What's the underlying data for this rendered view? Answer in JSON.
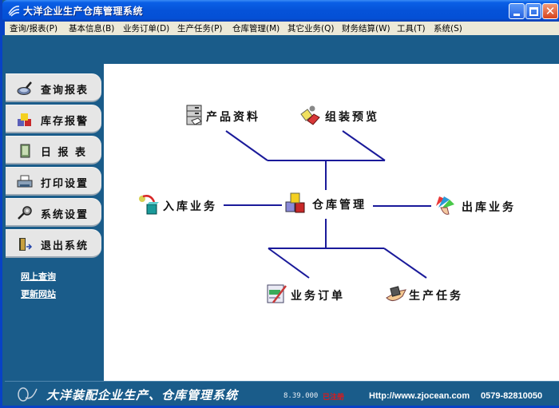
{
  "window": {
    "title": "大洋企业生产仓库管理系统",
    "controls": [
      "minimize",
      "maximize",
      "close"
    ]
  },
  "menu": [
    {
      "label": "查询/报表(P)"
    },
    {
      "label": "基本信息(B)"
    },
    {
      "label": "业务订单(D)"
    },
    {
      "label": "生产任务(P)"
    },
    {
      "label": "仓库管理(M)"
    },
    {
      "label": "其它业务(Q)"
    },
    {
      "label": "财务结算(W)"
    },
    {
      "label": "工具(T)"
    },
    {
      "label": "系统(S)"
    }
  ],
  "sidebar": {
    "buttons": [
      {
        "label": "查询报表",
        "icon": "magnifier-icon"
      },
      {
        "label": "库存报警",
        "icon": "stock-blocks-icon"
      },
      {
        "label": "日 报 表",
        "icon": "daily-report-icon"
      },
      {
        "label": "打印设置",
        "icon": "printer-icon"
      },
      {
        "label": "系统设置",
        "icon": "key-icon"
      },
      {
        "label": "退出系统",
        "icon": "exit-door-icon"
      }
    ],
    "links": [
      {
        "label": "网上查询"
      },
      {
        "label": "更新网站"
      }
    ]
  },
  "diagram": {
    "center": {
      "label": "仓库管理",
      "icon": "warehouse-blocks-icon"
    },
    "nodes": {
      "product_info": {
        "label": "产品资料",
        "icon": "file-cabinet-icon"
      },
      "assembly_preview": {
        "label": "组装预览",
        "icon": "assembly-icon"
      },
      "inbound": {
        "label": "入库业务",
        "icon": "inbound-box-icon"
      },
      "outbound": {
        "label": "出库业务",
        "icon": "outbound-cards-icon"
      },
      "orders": {
        "label": "业务订单",
        "icon": "order-form-icon"
      },
      "production": {
        "label": "生产任务",
        "icon": "production-hand-icon"
      }
    },
    "line_color": "#1a1a9a"
  },
  "footer": {
    "title": "大洋装配企业生产、仓库管理系统",
    "version": "8.39.000",
    "badge": "已注册",
    "url": "Http://www.zjocean.com",
    "phone": "0579-82810050"
  },
  "colors": {
    "panel_blue": "#1a5c8a",
    "title_blue": "#0552d8",
    "menu_bg": "#ece9d8",
    "button_gray": "#e6e6e6",
    "badge_red": "#e01818"
  }
}
